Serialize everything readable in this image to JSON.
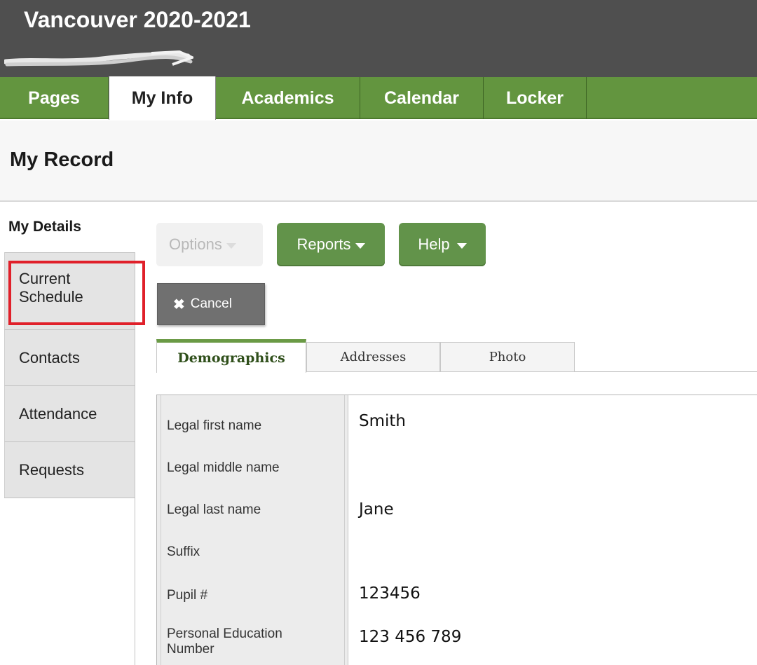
{
  "header": {
    "title": "Vancouver 2020-2021"
  },
  "nav": {
    "tabs": [
      {
        "label": "Pages"
      },
      {
        "label": "My Info"
      },
      {
        "label": "Academics"
      },
      {
        "label": "Calendar"
      },
      {
        "label": "Locker"
      }
    ],
    "active": "My Info"
  },
  "page": {
    "title": "My Record"
  },
  "sidebar": {
    "heading": "My Details",
    "items": [
      {
        "label_line1": "Current",
        "label_line2": "Schedule"
      },
      {
        "label": "Contacts"
      },
      {
        "label": "Attendance"
      },
      {
        "label": "Requests"
      }
    ],
    "highlighted": "Current Schedule"
  },
  "toolbar": {
    "options_label": "Options",
    "reports_label": "Reports",
    "help_label": "Help",
    "cancel_label": "Cancel"
  },
  "subtabs": [
    {
      "label": "Demographics"
    },
    {
      "label": "Addresses"
    },
    {
      "label": "Photo"
    }
  ],
  "fields": [
    {
      "label": "Legal first name",
      "value": "Smith"
    },
    {
      "label": "Legal middle name",
      "value": ""
    },
    {
      "label": "Legal last name",
      "value": "Jane"
    },
    {
      "label": "Suffix",
      "value": ""
    },
    {
      "label": "Pupil #",
      "value": "123456"
    },
    {
      "label_line1": "Personal Education",
      "label_line2": "Number",
      "value": "123 456 789"
    }
  ],
  "colors": {
    "header_bg": "#4f4f4f",
    "nav_green": "#63953f",
    "button_green": "#62934a",
    "highlight_red": "#e0202a"
  }
}
